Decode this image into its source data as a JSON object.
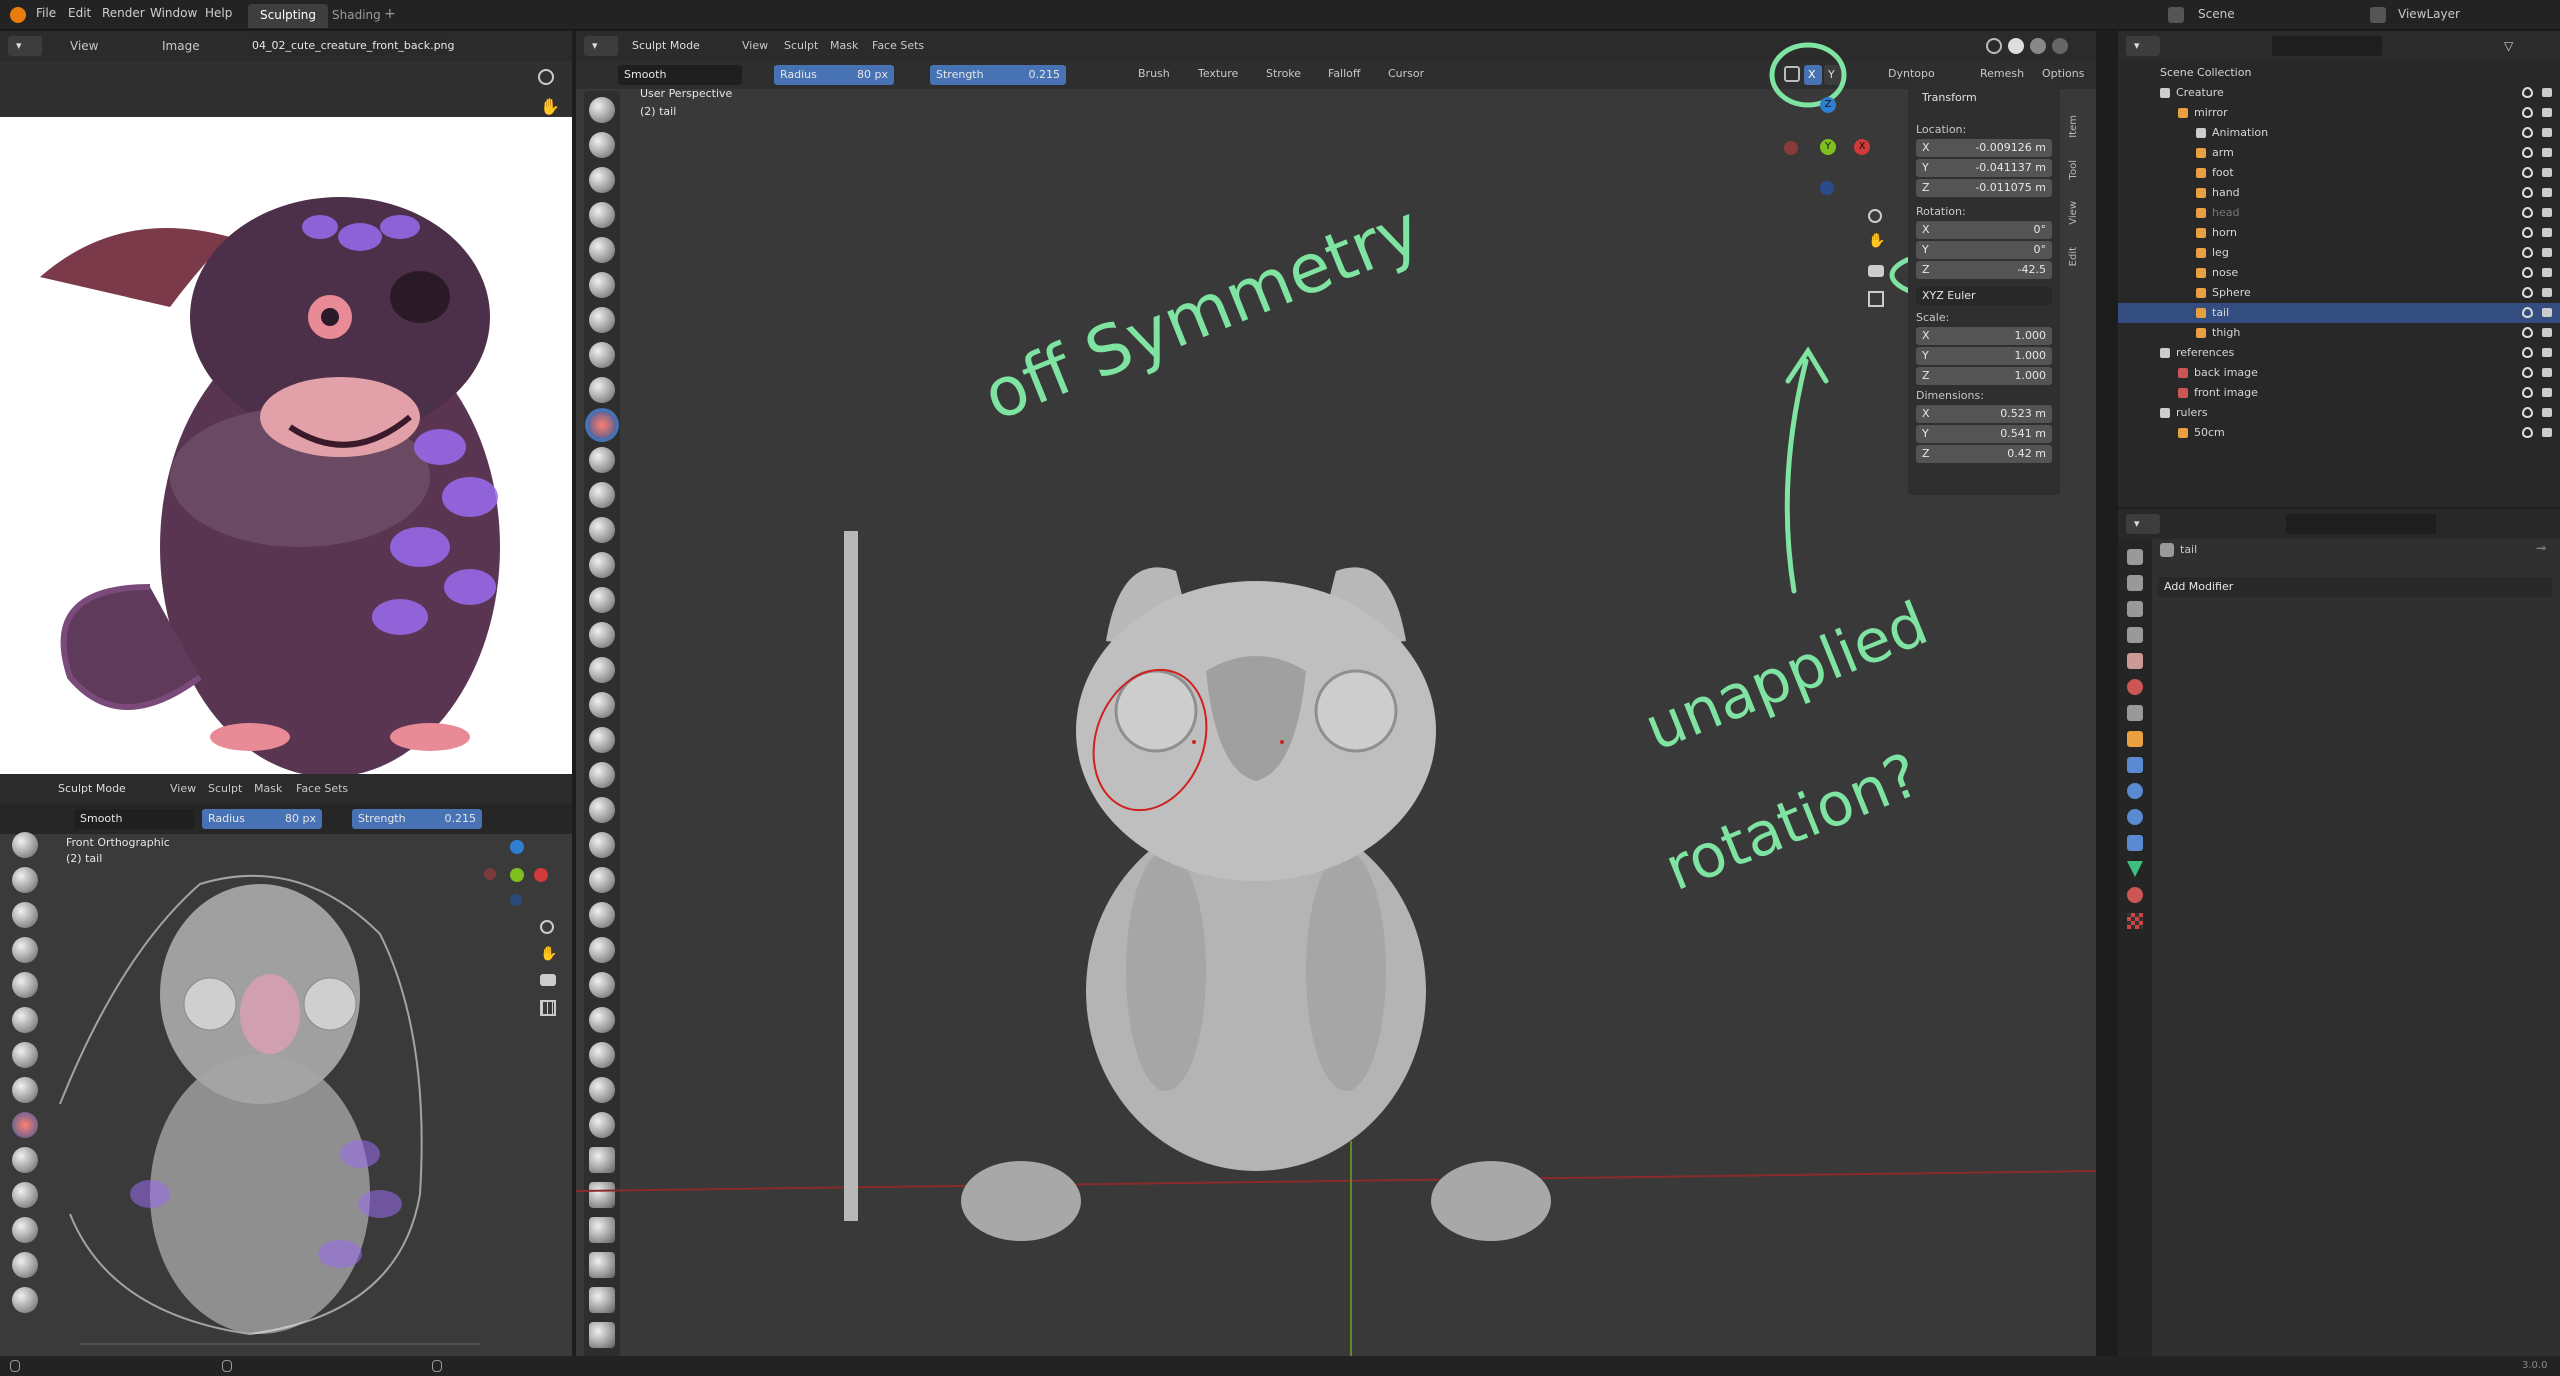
{
  "topbar": {
    "menus": [
      "File",
      "Edit",
      "Render",
      "Window",
      "Help"
    ],
    "tabs": [
      "Sculpting",
      "Shading"
    ],
    "scene": "Scene",
    "view_layer": "ViewLayer"
  },
  "image_editor": {
    "menus": [
      "View",
      "Image"
    ],
    "filename": "04_02_cute_creature_front_back.png"
  },
  "small_viewport": {
    "mode": "Sculpt Mode",
    "menus": [
      "View",
      "Sculpt",
      "Mask",
      "Face Sets"
    ],
    "brush": "Smooth",
    "radius_label": "Radius",
    "radius_value": "80 px",
    "strength_label": "Strength",
    "strength_value": "0.215",
    "view_name": "Front Orthographic",
    "object_name": "(2) tail"
  },
  "main_viewport": {
    "mode": "Sculpt Mode",
    "menus": [
      "View",
      "Sculpt",
      "Mask",
      "Face Sets"
    ],
    "brush": "Smooth",
    "radius_label": "Radius",
    "radius_value": "80 px",
    "strength_label": "Strength",
    "strength_value": "0.215",
    "dropdowns": [
      "Brush",
      "Texture",
      "Stroke",
      "Falloff",
      "Cursor"
    ],
    "right_menus": [
      "Dyntopo",
      "Remesh",
      "Options"
    ],
    "view_name": "User Perspective",
    "object_name": "(2) tail",
    "axis_x": "X",
    "axis_y": "Y",
    "gizmo_x": "X",
    "gizmo_y": "Y",
    "gizmo_z": "Z"
  },
  "transform": {
    "title": "Transform",
    "location_label": "Location:",
    "location": [
      [
        "X",
        "-0.009126 m"
      ],
      [
        "Y",
        "-0.041137 m"
      ],
      [
        "Z",
        "-0.011075 m"
      ]
    ],
    "rotation_label": "Rotation:",
    "rotation": [
      [
        "X",
        "0°"
      ],
      [
        "Y",
        "0°"
      ],
      [
        "Z",
        "-42.5"
      ]
    ],
    "rotation_mode": "XYZ Euler",
    "scale_label": "Scale:",
    "scale": [
      [
        "X",
        "1.000"
      ],
      [
        "Y",
        "1.000"
      ],
      [
        "Z",
        "1.000"
      ]
    ],
    "dimensions_label": "Dimensions:",
    "dimensions": [
      [
        "X",
        "0.523 m"
      ],
      [
        "Y",
        "0.541 m"
      ],
      [
        "Z",
        "0.42 m"
      ]
    ]
  },
  "side_tabs": [
    "Item",
    "Tool",
    "View",
    "Edit"
  ],
  "annotations": {
    "symmetry": "off Symmetry",
    "rotation": [
      "unapplied",
      "rotation?"
    ]
  },
  "outliner": {
    "root": "Scene Collection",
    "items": [
      {
        "label": "Creature",
        "depth": 1
      },
      {
        "label": "mirror",
        "depth": 2
      },
      {
        "label": "Animation",
        "depth": 3
      },
      {
        "label": "arm",
        "depth": 3
      },
      {
        "label": "foot",
        "depth": 3
      },
      {
        "label": "hand",
        "depth": 3
      },
      {
        "label": "head",
        "depth": 3
      },
      {
        "label": "horn",
        "depth": 3
      },
      {
        "label": "leg",
        "depth": 3
      },
      {
        "label": "nose",
        "depth": 3
      },
      {
        "label": "Sphere",
        "depth": 3
      },
      {
        "label": "tail",
        "depth": 3
      },
      {
        "label": "thigh",
        "depth": 3
      },
      {
        "label": "references",
        "depth": 1
      },
      {
        "label": "back image",
        "depth": 2
      },
      {
        "label": "front image",
        "depth": 2
      },
      {
        "label": "rulers",
        "depth": 1
      },
      {
        "label": "50cm",
        "depth": 2
      }
    ]
  },
  "properties": {
    "object": "tail",
    "add_modifier": "Add Modifier"
  },
  "status": {
    "version": "3.0.0"
  },
  "colors": {
    "accent_blue": "#4772b3",
    "annotation_green": "#7fe3a2",
    "selection_red": "#d02020"
  }
}
